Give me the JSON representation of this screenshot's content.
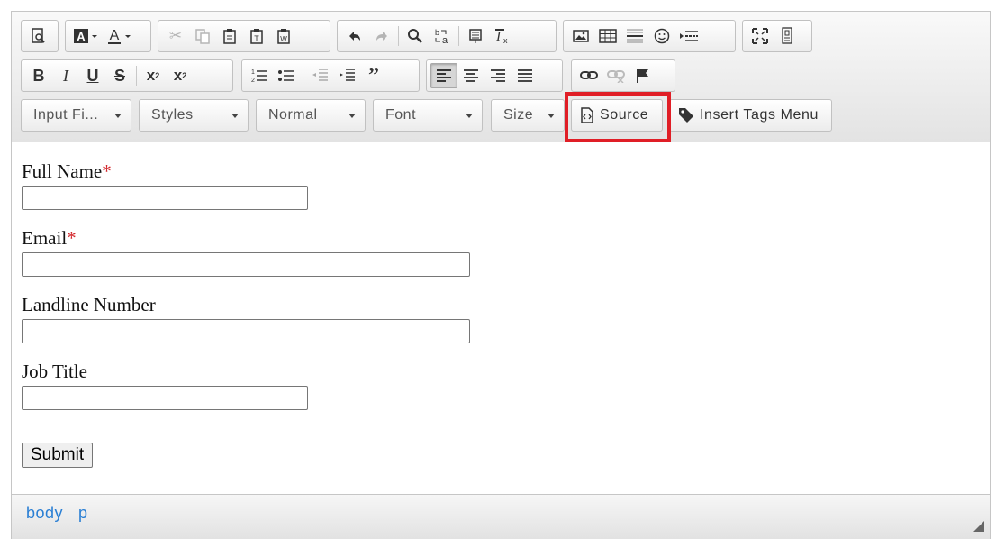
{
  "toolbar": {
    "row1": [
      {
        "name": "preview-icon",
        "glyph": "🔍︎",
        "disabled": false
      },
      {
        "name": "text-bg-color-icon",
        "glyph": "🅰▾",
        "disabled": false
      },
      {
        "name": "text-color-icon",
        "glyph": "A̲▾",
        "disabled": false
      },
      {
        "name": "cut-icon",
        "glyph": "✂",
        "disabled": true
      },
      {
        "name": "copy-icon",
        "glyph": "⧉",
        "disabled": true
      },
      {
        "name": "paste-icon",
        "glyph": "📋︎",
        "disabled": false
      },
      {
        "name": "paste-text-icon",
        "glyph": "📋︎",
        "disabled": false
      },
      {
        "name": "paste-word-icon",
        "glyph": "📋︎",
        "disabled": false
      },
      {
        "name": "undo-icon",
        "glyph": "↶",
        "disabled": false
      },
      {
        "name": "redo-icon",
        "glyph": "↷",
        "disabled": true
      },
      {
        "name": "find-icon",
        "glyph": "🔍︎",
        "disabled": false
      },
      {
        "name": "replace-icon",
        "glyph": "ᵇ⇆ₐ",
        "disabled": false
      },
      {
        "name": "select-all-icon",
        "glyph": "▤",
        "disabled": false
      },
      {
        "name": "remove-format-icon",
        "glyph": "Iₓ",
        "disabled": false
      },
      {
        "name": "image-icon",
        "glyph": "🖼︎",
        "disabled": false
      },
      {
        "name": "table-icon",
        "glyph": "▦",
        "disabled": false
      },
      {
        "name": "horizontal-line-icon",
        "glyph": "☰",
        "disabled": false
      },
      {
        "name": "smiley-icon",
        "glyph": "☺",
        "disabled": false
      },
      {
        "name": "page-break-icon",
        "glyph": "▸☰",
        "disabled": false
      },
      {
        "name": "maximize-icon",
        "glyph": "⛶",
        "disabled": false
      },
      {
        "name": "show-blocks-icon",
        "glyph": "▯",
        "disabled": false
      }
    ],
    "row2": [
      {
        "name": "bold-icon",
        "glyph": "B"
      },
      {
        "name": "italic-icon",
        "glyph": "I"
      },
      {
        "name": "underline-icon",
        "glyph": "U"
      },
      {
        "name": "strikethrough-icon",
        "glyph": "S"
      },
      {
        "name": "subscript-icon",
        "glyph": "x₂"
      },
      {
        "name": "superscript-icon",
        "glyph": "x²"
      },
      {
        "name": "numbered-list-icon",
        "glyph": "⒈☰"
      },
      {
        "name": "bulleted-list-icon",
        "glyph": "•☰"
      },
      {
        "name": "decrease-indent-icon",
        "glyph": "⇤☰"
      },
      {
        "name": "increase-indent-icon",
        "glyph": "⇥☰"
      },
      {
        "name": "blockquote-icon",
        "glyph": "❞"
      },
      {
        "name": "align-left-icon",
        "glyph": "☰"
      },
      {
        "name": "align-center-icon",
        "glyph": "☰"
      },
      {
        "name": "align-right-icon",
        "glyph": "☰"
      },
      {
        "name": "justify-icon",
        "glyph": "☰"
      },
      {
        "name": "link-icon",
        "glyph": "🔗︎"
      },
      {
        "name": "unlink-icon",
        "glyph": "⛓"
      },
      {
        "name": "anchor-flag-icon",
        "glyph": "⚑"
      }
    ],
    "combos": {
      "input_field": "Input Fi...",
      "styles": "Styles",
      "format": "Normal",
      "font": "Font",
      "size": "Size"
    },
    "source_label": "Source",
    "insert_tags_label": "Insert Tags Menu"
  },
  "form": {
    "full_name_label": "Full Name",
    "email_label": "Email",
    "required_mark": "*",
    "landline_label": "Landline Number",
    "job_title_label": "Job Title",
    "submit_label": "Submit"
  },
  "statusbar": {
    "path": [
      "body",
      "p"
    ]
  },
  "colors": {
    "highlight": "#e01e26",
    "required": "#d3262b",
    "path_link": "#2a7fd4"
  }
}
